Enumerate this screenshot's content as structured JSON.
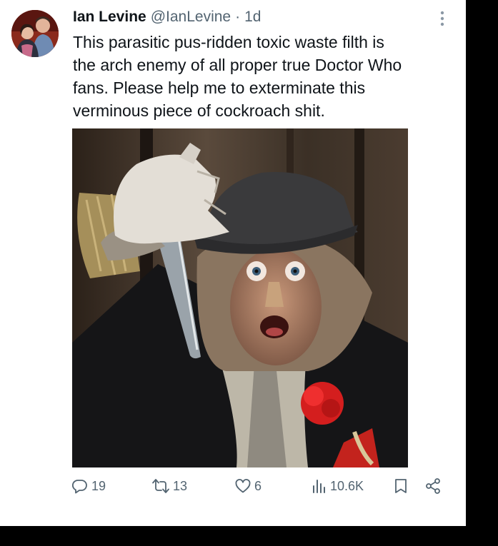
{
  "tweet": {
    "author_name": "Ian Levine",
    "author_handle": "@IanLevine",
    "separator": "·",
    "time": "1d",
    "text": "This parasitic pus-ridden toxic waste filth is\nthe arch enemy of all proper true Doctor Who\nfans. Please help me to exterminate this\nverminous piece of cockroach shit."
  },
  "actions": {
    "replies": "19",
    "reposts": "13",
    "likes": "6",
    "views": "10.6K"
  },
  "icons": {
    "more": "more-vertical-icon",
    "reply": "reply-icon",
    "repost": "repost-icon",
    "like": "heart-icon",
    "views": "views-icon",
    "bookmark": "bookmark-icon",
    "share": "share-icon"
  },
  "colors": {
    "text": "#0f1419",
    "secondary": "#536471",
    "background": "#ffffff",
    "frame": "#000000"
  }
}
